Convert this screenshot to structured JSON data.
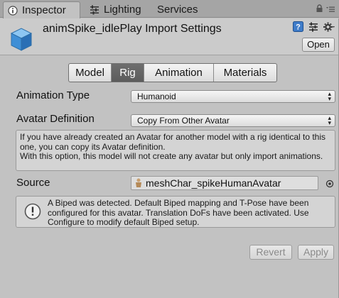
{
  "window_tabs": [
    {
      "label": "Inspector",
      "icon": "info-icon",
      "active": true
    },
    {
      "label": "Lighting",
      "icon": "lighting-icon",
      "active": false
    },
    {
      "label": "Services",
      "active": false
    }
  ],
  "tabbar_icons": [
    "lock-icon",
    "menu-icon"
  ],
  "header": {
    "title": "animSpike_idlePlay Import Settings",
    "asset_icon": "model-cube-icon",
    "icons": [
      "help-icon",
      "preset-icon",
      "settings-gear-icon"
    ],
    "open_label": "Open"
  },
  "importer_tabs": [
    {
      "label": "Model",
      "active": false
    },
    {
      "label": "Rig",
      "active": true
    },
    {
      "label": "Animation",
      "active": false
    },
    {
      "label": "Materials",
      "active": false
    }
  ],
  "animation_type": {
    "label": "Animation Type",
    "value": "Humanoid"
  },
  "avatar_definition": {
    "label": "Avatar Definition",
    "value": "Copy From Other Avatar"
  },
  "info_text": "If you have already created an Avatar for another model with a rig identical to this one, you can copy its Avatar definition.\nWith this option, this model will not create any avatar but only import animations.",
  "source": {
    "label": "Source",
    "value": "meshChar_spikeHumanAvatar",
    "icon": "avatar-icon",
    "picker_icon": "object-picker-icon"
  },
  "biped_message": {
    "icon": "warning-icon",
    "text": "A Biped was detected. Default Biped mapping and T-Pose have been configured for this avatar. Translation DoFs have been activated. Use Configure to modify default Biped setup."
  },
  "buttons": {
    "revert": "Revert",
    "apply": "Apply"
  },
  "colors": {
    "panel_bg": "#c2c2c2",
    "tab_active": "#5c5c5c",
    "asset_icon_blue": "#3f8fd6"
  }
}
